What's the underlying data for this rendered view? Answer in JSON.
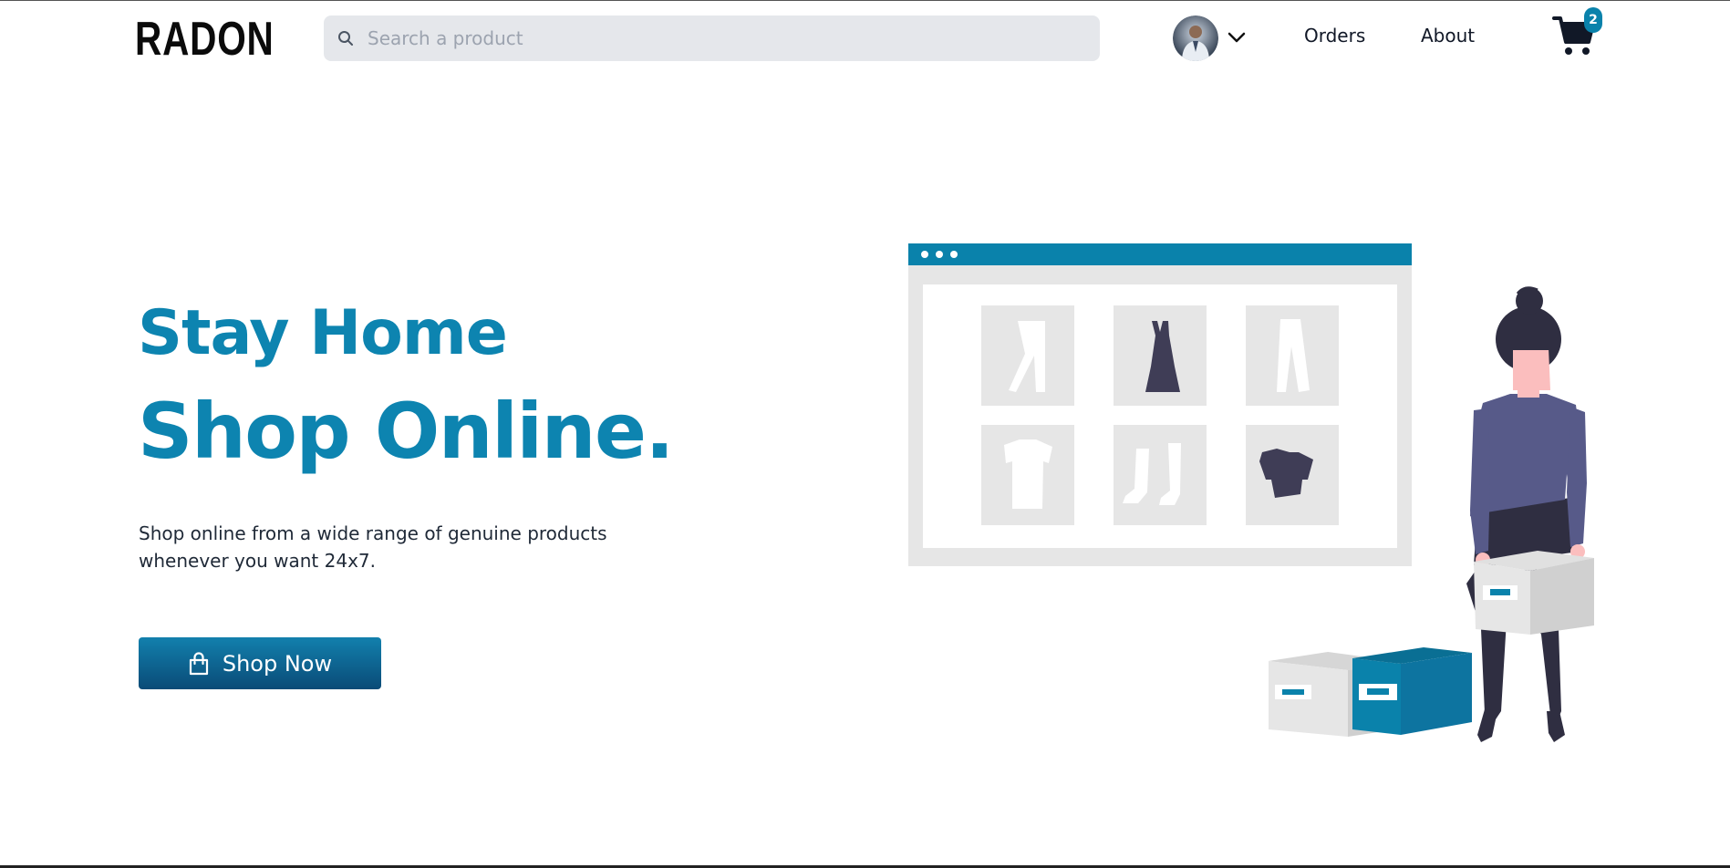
{
  "header": {
    "logo": "RADON",
    "search_placeholder": "Search a product",
    "nav": {
      "orders": "Orders",
      "about": "About"
    },
    "cart_count": "2"
  },
  "hero": {
    "line1": "Stay Home",
    "line2": "Shop Online.",
    "description": "Shop online from a wide range of genuine products whenever you want 24x7.",
    "cta_label": "Shop Now"
  },
  "colors": {
    "brand": "#0d84b0",
    "button_top": "#1280ad",
    "button_bottom": "#0a4b77",
    "search_bg": "#e5e7eb"
  },
  "icons": {
    "search": "search-icon",
    "avatar": "avatar",
    "menu": "chevron-down-icon",
    "cart": "cart-icon",
    "cta": "shopping-bag-icon"
  }
}
